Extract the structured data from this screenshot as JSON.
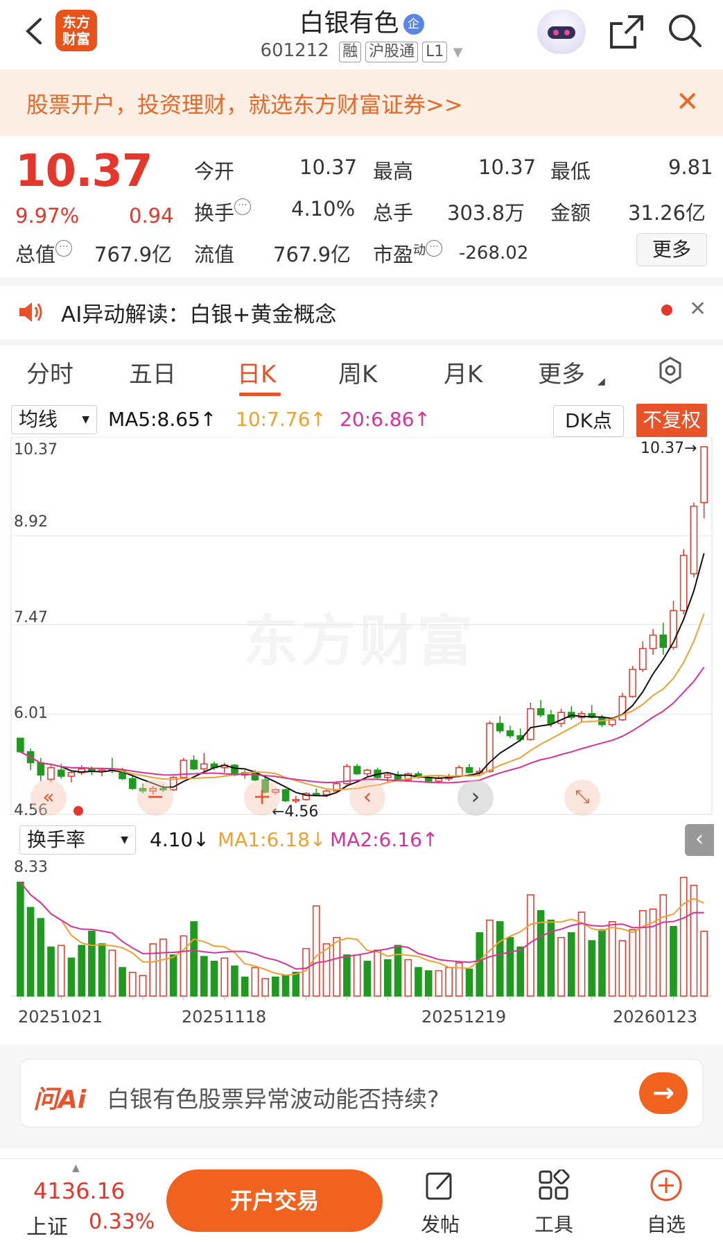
{
  "header": {
    "back_icon": "chevron-left-icon",
    "logo_text": "东方财富",
    "title": "白银有色",
    "badge": "企",
    "code": "601212",
    "tags": [
      "融",
      "沪股通",
      "L1"
    ],
    "share_icon": "share-icon",
    "search_icon": "search-icon"
  },
  "banner": {
    "text": "股票开户，投资理财，就选东方财富证券>>",
    "close": "✕"
  },
  "quote": {
    "price": "10.37",
    "change_pct": "9.97%",
    "change": "0.94",
    "open_label": "今开",
    "open": "10.37",
    "high_label": "最高",
    "high": "10.37",
    "low_label": "最低",
    "low": "9.81",
    "turnover_label": "换手",
    "turnover": "4.10%",
    "volume_label": "总手",
    "volume": "303.8万",
    "amount_label": "金额",
    "amount": "31.26亿",
    "mcap_label": "总值",
    "mcap": "767.9亿",
    "float_label": "流值",
    "float": "767.9亿",
    "pe_label": "市盈",
    "pe_sup": "动",
    "pe": "-268.02",
    "more": "更多"
  },
  "ai_alert": {
    "text": "AI异动解读：白银+黄金概念",
    "close": "✕"
  },
  "tabs": [
    "分时",
    "五日",
    "日K",
    "周K",
    "月K",
    "更多"
  ],
  "active_tab": "日K",
  "ma_row": {
    "dropdown": "均线",
    "ma5": "MA5:8.65↑",
    "ma10": "10:7.76↑",
    "ma20": "20:6.86↑",
    "dk": "DK点",
    "fq": "不复权"
  },
  "kline": {
    "y_labels": [
      "10.37",
      "8.92",
      "7.47",
      "6.01",
      "4.56"
    ],
    "max_label": "10.37→",
    "min_label": "←4.56"
  },
  "turn_row": {
    "dropdown": "换手率",
    "value": "4.10↓",
    "ma1": "MA1:6.18↓",
    "ma2": "MA2:6.16↑",
    "y_max": "8.33"
  },
  "dates": [
    "20251021",
    "20251118",
    "20251219",
    "20260123"
  ],
  "watermark": "东方财富",
  "colors": {
    "up": "#e4362b",
    "down": "#1f9a1f",
    "ma5": "#111111",
    "ma10": "#f0a030",
    "ma20": "#d6339a",
    "accent": "#e8532a"
  },
  "chart_data": [
    {
      "type": "candlestick",
      "title": "日K",
      "ylim": [
        4.56,
        10.37
      ],
      "series": [
        {
          "name": "MA5",
          "current": 8.65
        },
        {
          "name": "10",
          "current": 7.76
        },
        {
          "name": "20",
          "current": 6.86
        }
      ],
      "ohlc": [
        [
          5.62,
          5.62,
          5.38,
          5.4
        ],
        [
          5.4,
          5.45,
          5.1,
          5.22
        ],
        [
          5.22,
          5.3,
          4.92,
          5.02
        ],
        [
          4.95,
          5.18,
          4.9,
          5.14
        ],
        [
          5.1,
          5.2,
          4.96,
          5.0
        ],
        [
          5.0,
          5.08,
          4.9,
          5.06
        ],
        [
          5.06,
          5.18,
          5.02,
          5.12
        ],
        [
          5.12,
          5.16,
          5.02,
          5.08
        ],
        [
          5.08,
          5.14,
          5.0,
          5.1
        ],
        [
          5.12,
          5.3,
          5.05,
          5.1
        ],
        [
          5.1,
          5.14,
          4.94,
          4.96
        ],
        [
          4.96,
          5.0,
          4.78,
          4.8
        ],
        [
          4.8,
          4.88,
          4.72,
          4.76
        ],
        [
          4.76,
          4.84,
          4.7,
          4.8
        ],
        [
          4.8,
          4.86,
          4.74,
          4.78
        ],
        [
          4.78,
          5.0,
          4.76,
          4.98
        ],
        [
          4.98,
          5.3,
          4.96,
          5.26
        ],
        [
          5.26,
          5.34,
          5.1,
          5.12
        ],
        [
          5.12,
          5.38,
          5.08,
          5.2
        ],
        [
          5.2,
          5.24,
          5.1,
          5.14
        ],
        [
          5.14,
          5.22,
          5.06,
          5.18
        ],
        [
          5.18,
          5.2,
          5.0,
          5.02
        ],
        [
          5.02,
          5.1,
          4.96,
          5.06
        ],
        [
          5.06,
          5.1,
          4.92,
          4.94
        ],
        [
          4.94,
          4.98,
          4.72,
          4.74
        ],
        [
          4.74,
          4.8,
          4.7,
          4.78
        ],
        [
          4.78,
          4.8,
          4.58,
          4.6
        ],
        [
          4.6,
          4.68,
          4.56,
          4.62
        ],
        [
          4.62,
          4.74,
          4.6,
          4.72
        ],
        [
          4.72,
          4.8,
          4.68,
          4.7
        ],
        [
          4.7,
          4.78,
          4.66,
          4.76
        ],
        [
          4.76,
          4.92,
          4.74,
          4.88
        ],
        [
          4.88,
          5.2,
          4.86,
          5.16
        ],
        [
          5.16,
          5.2,
          5.02,
          5.04
        ],
        [
          5.04,
          5.12,
          5.0,
          5.1
        ],
        [
          5.1,
          5.14,
          4.96,
          4.98
        ],
        [
          4.98,
          5.06,
          4.9,
          5.02
        ],
        [
          5.02,
          5.08,
          4.92,
          4.94
        ],
        [
          4.94,
          5.06,
          4.92,
          5.04
        ],
        [
          5.04,
          5.08,
          4.96,
          4.98
        ],
        [
          4.98,
          5.02,
          4.9,
          4.92
        ],
        [
          4.92,
          5.0,
          4.88,
          4.96
        ],
        [
          4.96,
          5.04,
          4.92,
          5.0
        ],
        [
          5.0,
          5.18,
          4.98,
          5.14
        ],
        [
          5.14,
          5.2,
          5.04,
          5.06
        ],
        [
          5.06,
          5.14,
          5.0,
          5.08
        ],
        [
          5.08,
          5.9,
          5.06,
          5.86
        ],
        [
          5.86,
          5.98,
          5.7,
          5.74
        ],
        [
          5.74,
          5.82,
          5.62,
          5.66
        ],
        [
          5.66,
          5.78,
          5.56,
          5.6
        ],
        [
          5.6,
          6.2,
          5.58,
          6.1
        ],
        [
          6.1,
          6.24,
          5.96,
          6.0
        ],
        [
          6.0,
          6.08,
          5.8,
          5.86
        ],
        [
          5.86,
          6.1,
          5.8,
          6.04
        ],
        [
          6.04,
          6.14,
          5.92,
          5.96
        ],
        [
          5.96,
          6.06,
          5.88,
          6.02
        ],
        [
          6.02,
          6.16,
          5.94,
          5.96
        ],
        [
          5.96,
          6.0,
          5.8,
          5.84
        ],
        [
          5.84,
          5.96,
          5.8,
          5.92
        ],
        [
          5.92,
          6.36,
          5.9,
          6.3
        ],
        [
          6.3,
          6.8,
          6.28,
          6.74
        ],
        [
          6.74,
          7.2,
          6.7,
          7.08
        ],
        [
          7.08,
          7.4,
          6.98,
          7.3
        ],
        [
          7.3,
          7.5,
          6.98,
          7.1
        ],
        [
          7.1,
          7.86,
          7.06,
          7.7
        ],
        [
          7.7,
          8.7,
          7.64,
          8.6
        ],
        [
          8.3,
          9.46,
          8.24,
          9.4
        ],
        [
          9.46,
          10.37,
          9.2,
          10.37
        ]
      ]
    },
    {
      "type": "bar",
      "title": "换手率",
      "ylim": [
        0,
        8.33
      ],
      "series": [
        {
          "name": "MA1",
          "current": 6.18
        },
        {
          "name": "MA2",
          "current": 6.16
        }
      ],
      "values": [
        7.2,
        5.6,
        4.9,
        3.1,
        3.2,
        2.4,
        3.2,
        4.1,
        3.3,
        2.9,
        1.8,
        1.5,
        1.3,
        3.3,
        3.6,
        2.6,
        3.8,
        4.7,
        2.5,
        2.2,
        2.4,
        1.9,
        1.2,
        1.8,
        1.1,
        1.2,
        1.3,
        1.5,
        3.0,
        5.7,
        3.3,
        3.7,
        2.6,
        2.6,
        2.2,
        2.9,
        2.3,
        3.2,
        2.3,
        1.8,
        1.6,
        1.6,
        1.8,
        2.1,
        1.7,
        4.0,
        4.8,
        4.7,
        3.7,
        3.1,
        6.4,
        5.4,
        4.8,
        3.7,
        4.0,
        5.3,
        3.5,
        4.2,
        4.7,
        3.5,
        4.2,
        5.4,
        5.5,
        6.4,
        4.4,
        7.5,
        7.0,
        4.1
      ],
      "down_flags": [
        1,
        1,
        1,
        1,
        0,
        1,
        1,
        1,
        1,
        0,
        1,
        0,
        0,
        0,
        0,
        1,
        0,
        1,
        1,
        1,
        0,
        1,
        1,
        0,
        0,
        1,
        1,
        1,
        0,
        0,
        0,
        0,
        1,
        0,
        1,
        0,
        1,
        1,
        0,
        1,
        1,
        0,
        0,
        0,
        1,
        1,
        0,
        1,
        1,
        1,
        0,
        1,
        1,
        0,
        1,
        0,
        1,
        1,
        0,
        0,
        0,
        0,
        0,
        0,
        1,
        0,
        0,
        0
      ]
    }
  ],
  "ask_ai": {
    "logo": "问Ai",
    "text": "白银有色股票异常波动能否持续?",
    "go": "→"
  },
  "bottom_bar": {
    "index_value": "4136.16",
    "index_name": "上证",
    "index_pct": "0.33%",
    "trade": "开户交易",
    "post": "发帖",
    "tools": "工具",
    "add": "自选"
  }
}
